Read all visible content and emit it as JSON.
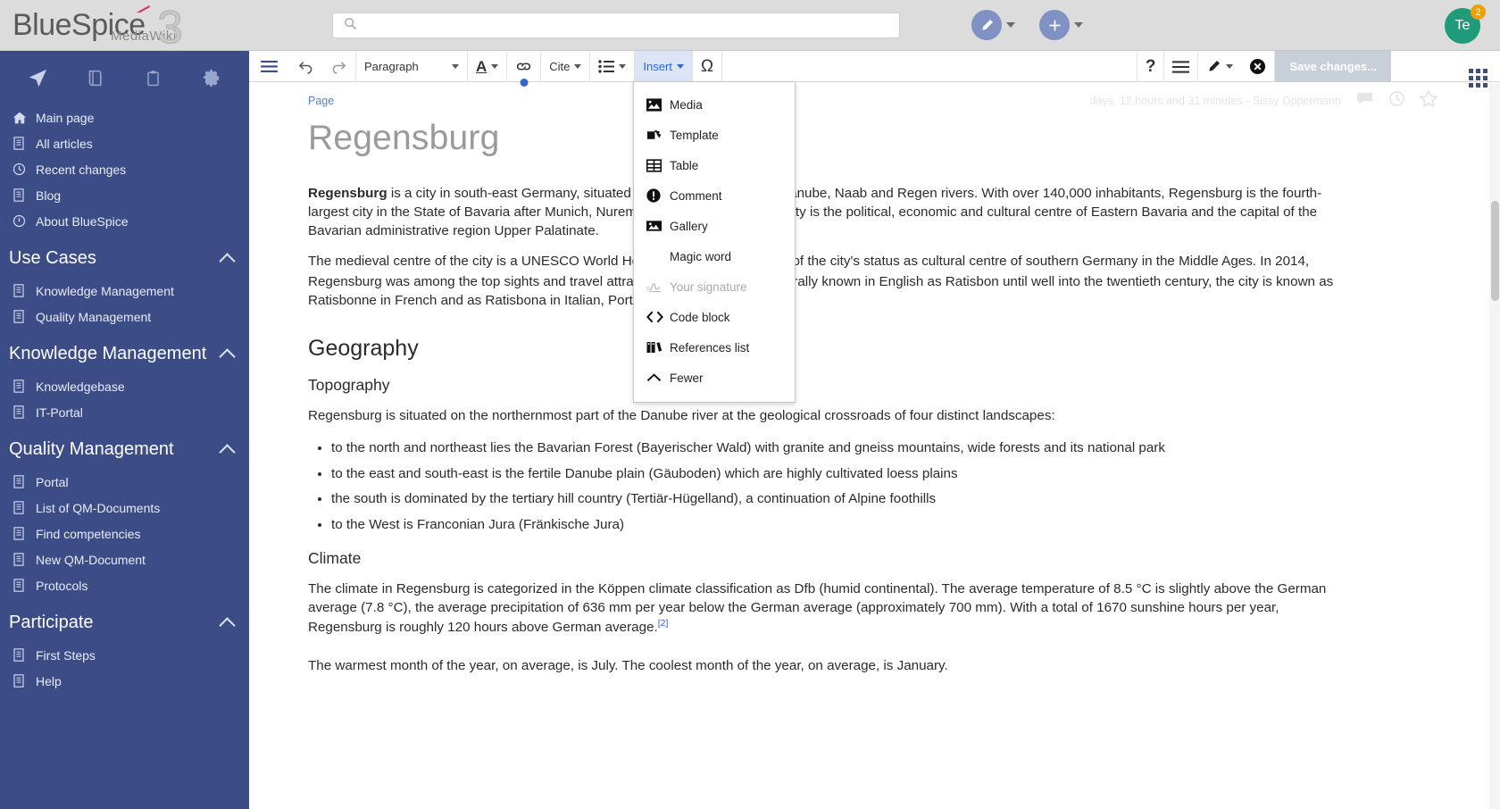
{
  "header": {
    "logo_main": "BlueSpice",
    "logo_sub": "MediaWiki",
    "logo_version": "3",
    "search_placeholder": "",
    "search_value": "",
    "edit_button_icon": "pencil-icon",
    "add_button_icon": "plus-icon",
    "avatar_initials": "Te",
    "avatar_badge": "2",
    "avatar_color": "#1f9b7a",
    "badge_color": "#f0a000"
  },
  "sidebar": {
    "bg_color": "#3b4c86",
    "top_icons": [
      {
        "name": "navigation-icon",
        "label": "Navigation"
      },
      {
        "name": "book-icon",
        "label": "Book"
      },
      {
        "name": "clipboard-icon",
        "label": "Clipboard"
      },
      {
        "name": "gear-icon",
        "label": "Settings"
      }
    ],
    "main_items": [
      {
        "label": "Main page",
        "icon": "home-icon"
      },
      {
        "label": "All articles",
        "icon": "article-icon"
      },
      {
        "label": "Recent changes",
        "icon": "clock-icon"
      },
      {
        "label": "Blog",
        "icon": "article-icon"
      },
      {
        "label": "About BlueSpice",
        "icon": "info-icon"
      }
    ],
    "sections": [
      {
        "title": "Use Cases",
        "collapsed": false,
        "items": [
          {
            "label": "Knowledge Management",
            "icon": "article-icon"
          },
          {
            "label": "Quality Management",
            "icon": "article-icon"
          }
        ]
      },
      {
        "title": "Knowledge Management",
        "collapsed": false,
        "items": [
          {
            "label": "Knowledgebase",
            "icon": "article-icon"
          },
          {
            "label": "IT-Portal",
            "icon": "article-icon"
          }
        ]
      },
      {
        "title": "Quality Management",
        "collapsed": false,
        "items": [
          {
            "label": "Portal",
            "icon": "article-icon"
          },
          {
            "label": "List of QM-Documents",
            "icon": "article-icon"
          },
          {
            "label": "Find competencies",
            "icon": "article-icon"
          },
          {
            "label": "New QM-Document",
            "icon": "article-icon"
          },
          {
            "label": "Protocols",
            "icon": "article-icon"
          }
        ]
      },
      {
        "title": "Participate",
        "collapsed": false,
        "items": [
          {
            "label": "First Steps",
            "icon": "article-icon"
          },
          {
            "label": "Help",
            "icon": "article-icon"
          }
        ]
      }
    ]
  },
  "toolbar": {
    "undo_label": "Undo",
    "redo_label": "Redo",
    "paragraph_style": "Paragraph",
    "text_style_label": "A",
    "link_label": "Link",
    "cite_label": "Cite",
    "list_label": "List",
    "insert_label": "Insert",
    "special_char_label": "Ω",
    "help_label": "?",
    "page_options_label": "Page options",
    "switch_editor_label": "Switch editor",
    "cancel_label": "Cancel",
    "save_label": "Save changes..."
  },
  "insert_menu": {
    "open": true,
    "items": [
      {
        "label": "Media",
        "icon": "image-icon",
        "disabled": false
      },
      {
        "label": "Template",
        "icon": "template-icon",
        "disabled": false
      },
      {
        "label": "Table",
        "icon": "table-icon",
        "disabled": false
      },
      {
        "label": "Comment",
        "icon": "comment-icon",
        "disabled": false
      },
      {
        "label": "Gallery",
        "icon": "gallery-icon",
        "disabled": false
      },
      {
        "label": "Magic word",
        "icon": "none",
        "disabled": false
      },
      {
        "label": "Your signature",
        "icon": "signature-icon",
        "disabled": true
      },
      {
        "label": "Code block",
        "icon": "code-icon",
        "disabled": false
      },
      {
        "label": "References list",
        "icon": "references-icon",
        "disabled": false
      },
      {
        "label": "Fewer",
        "icon": "chevron-up-icon",
        "disabled": false
      }
    ]
  },
  "breadcrumb": {
    "label": "Page",
    "meta": "days, 12 hours and 31 minutes - Sissy Oppermann",
    "icons": [
      "discussion-icon",
      "history-icon",
      "star-icon"
    ]
  },
  "article": {
    "title": "Regensburg",
    "intro_bold": "Regensburg",
    "intro_rest": " is a city in south-east Germany, situated at the confluence of the Danube, Naab and Regen rivers. With over 140,000 inhabitants, Regensburg is the fourth-largest city in the State of Bavaria after Munich, Nuremberg and Augsburg. The city is the political, economic and cultural centre of Eastern Bavaria and the capital of the Bavarian administrative region Upper Palatinate.",
    "para2_a": "The medieval centre of the city is a UNESCO World Heritage Site, in recognition of the city's status as cultural centre of southern Germany in the Middle Ages. In 2014, Regensburg was among the top sights and travel attractions in Germany.",
    "para2_ref": "[1]",
    "para2_b": " Generally known in English as Ratisbon until well into the twentieth century, the city is known as Ratisbonne in French and as Ratisbona in Italian, Portuguese and Spanish.",
    "geography_heading": "Geography",
    "topography_heading": "Topography",
    "topography_intro": "Regensburg is situated on the northernmost part of the Danube river at the geological crossroads of four distinct landscapes:",
    "topography_bullets": [
      "to the north and northeast lies the Bavarian Forest (Bayerischer Wald) with granite and gneiss mountains, wide forests and its national park",
      "to the east and south-east is the fertile Danube plain (Gäuboden) which are highly cultivated loess plains",
      "the south is dominated by the tertiary hill country (Tertiär-Hügelland), a continuation of Alpine foothills",
      "to the West is Franconian Jura (Fränkische Jura)"
    ],
    "climate_heading": "Climate",
    "climate_a": "The climate in Regensburg is categorized in the Köppen climate classification as Dfb (humid continental). The average temperature of 8.5 °C is slightly above the German average (7.8 °C), the average precipitation of 636 mm per year below the German average (approximately 700 mm). With a total of 1670 sunshine hours per year, Regensburg is roughly 120 hours above German average.",
    "climate_ref": "[2]",
    "climate_b": "The warmest month of the year, on average, is July. The coolest month of the year, on average, is January."
  }
}
